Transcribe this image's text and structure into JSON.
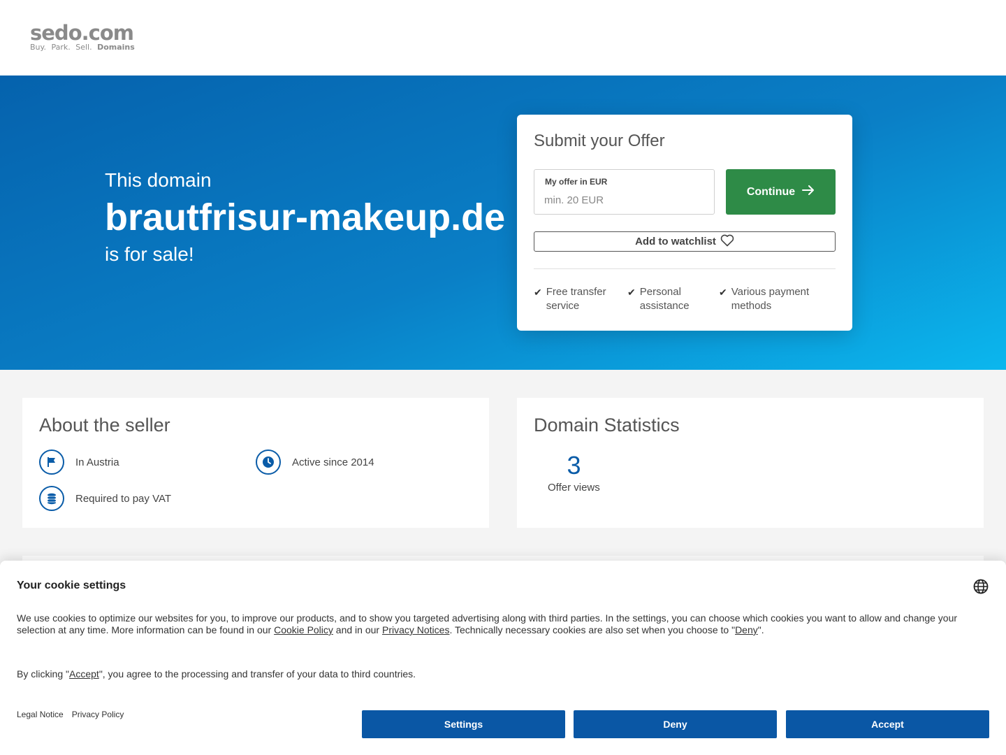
{
  "header": {
    "logo_main": "sedo.com",
    "logo_tagline": "Buy. Park. Sell.",
    "logo_tagline_bold": "Domains"
  },
  "hero": {
    "line1": "This domain",
    "domain": "brautfrisur-makeup.de",
    "line3": "is for sale!"
  },
  "offer": {
    "title": "Submit your Offer",
    "input_label": "My offer in EUR",
    "input_placeholder": "min. 20 EUR",
    "input_value": "",
    "continue_label": "Continue",
    "watchlist_label": "Add to watchlist",
    "features": [
      {
        "line1": "Free transfer",
        "line2": "service"
      },
      {
        "line1": "Personal",
        "line2": "assistance"
      },
      {
        "line1": "Various payment",
        "line2": "methods"
      }
    ]
  },
  "seller": {
    "title": "About the seller",
    "items": [
      {
        "label": "In Austria",
        "icon": "flag-icon"
      },
      {
        "label": "Active since 2014",
        "icon": "clock-icon"
      },
      {
        "label": "Required to pay VAT",
        "icon": "coins-icon"
      }
    ]
  },
  "stats": {
    "title": "Domain Statistics",
    "value": "3",
    "label": "Offer views"
  },
  "cookie": {
    "title": "Your cookie settings",
    "text_part1": "We use cookies to optimize our websites for you, to improve our products, and to show you targeted advertising along with third parties. In the settings, you can choose which cookies you want to allow and change your selection at any time. More information can be found in our ",
    "cookie_policy_link": "Cookie Policy",
    "text_part2": " and in our ",
    "privacy_notices_link": "Privacy Notices",
    "text_part3": ". Technically necessary cookies are also set when you choose to \"",
    "deny_link": "Deny",
    "text_part4": "\".",
    "text2_part1": "By clicking \"",
    "accept_link": "Accept",
    "text2_part2": "\", you agree to the processing and transfer of your data to third countries.",
    "legal_notice": "Legal Notice",
    "privacy_policy": "Privacy Policy",
    "settings_label": "Settings",
    "deny_label": "Deny",
    "accept_label": "Accept"
  },
  "colors": {
    "brand_blue": "#0a57a5",
    "continue_green": "#2e8b47",
    "hero_gradient_start": "#0562ad",
    "hero_gradient_end": "#0bb7ee"
  }
}
